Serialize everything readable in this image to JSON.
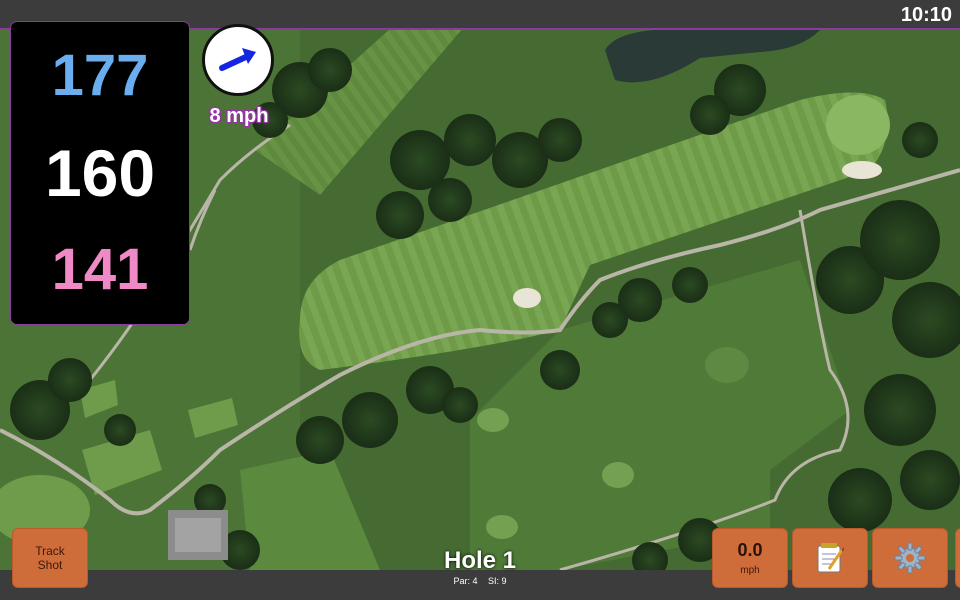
{
  "status_bar": {
    "time": "10:10"
  },
  "yardages": {
    "back": "177",
    "middle": "160",
    "front": "141"
  },
  "wind": {
    "speed_label": "8 mph",
    "direction_icon": "arrow-right-up-icon"
  },
  "hole": {
    "title": "Hole 1",
    "par_label": "Par: 4",
    "si_label": "SI: 9"
  },
  "buttons": {
    "track_shot_line1": "Track",
    "track_shot_line2": "Shot",
    "speed_value": "0.0",
    "speed_unit": "mph",
    "notes_icon": "notepad-icon",
    "settings_icon": "gear-icon"
  },
  "colors": {
    "back_yardage": "#6aaef0",
    "middle_yardage": "#ffffff",
    "front_yardage": "#f08ac6",
    "button": "#cf6d3a",
    "accent": "#8a3aa0",
    "wind_arrow": "#1426e0"
  }
}
